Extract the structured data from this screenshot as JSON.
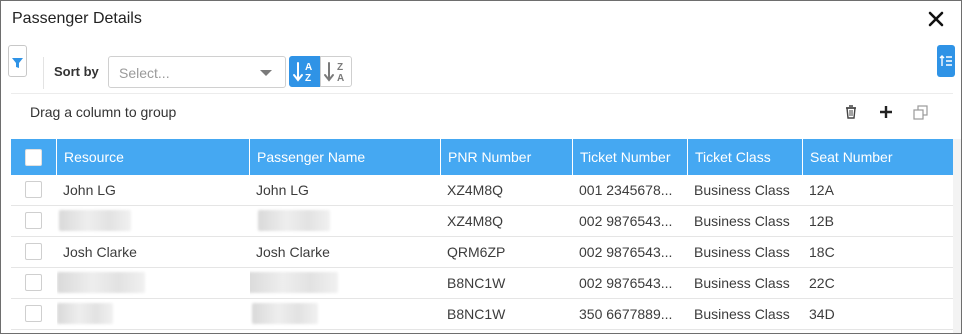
{
  "dialog": {
    "title": "Passenger Details",
    "close_icon": "close-icon"
  },
  "toolbar": {
    "filter_icon": "filter-icon",
    "sort_by_label": "Sort by",
    "sort_select_placeholder": "Select...",
    "sort_ascending_icon": "sort-ascending-icon",
    "sort_descending_icon": "sort-descending-icon",
    "sort_ascending_letters": [
      "A",
      "Z"
    ],
    "sort_descending_letters": [
      "Z",
      "A"
    ],
    "columns_icon": "column-chooser-icon"
  },
  "group_panel": {
    "text": "Drag a column to group",
    "actions": [
      "delete-icon",
      "add-icon",
      "copy-icon"
    ]
  },
  "grid": {
    "columns": [
      "Resource",
      "Passenger Name",
      "PNR Number",
      "Ticket Number",
      "Ticket Class",
      "Seat Number"
    ],
    "rows": [
      {
        "resource": "John LG",
        "passenger_name": "John LG",
        "pnr": "XZ4M8Q",
        "ticket_number": "001 2345678...",
        "ticket_class": "Business Class",
        "seat": "12A"
      },
      {
        "resource": "",
        "passenger_name": "",
        "pnr": "XZ4M8Q",
        "ticket_number": "002 9876543...",
        "ticket_class": "Business Class",
        "seat": "12B"
      },
      {
        "resource": "Josh Clarke",
        "passenger_name": "Josh Clarke",
        "pnr": "QRM6ZP",
        "ticket_number": "002 9876543...",
        "ticket_class": "Business Class",
        "seat": "18C"
      },
      {
        "resource": "",
        "passenger_name": "",
        "pnr": "B8NC1W",
        "ticket_number": "002 9876543...",
        "ticket_class": "Business Class",
        "seat": "22C"
      },
      {
        "resource": "",
        "passenger_name": "",
        "pnr": "B8NC1W",
        "ticket_number": "350 6677889...",
        "ticket_class": "Business Class",
        "seat": "34D"
      }
    ]
  },
  "colors": {
    "accent": "#2f93e6",
    "header_bg": "#45a8f2"
  }
}
